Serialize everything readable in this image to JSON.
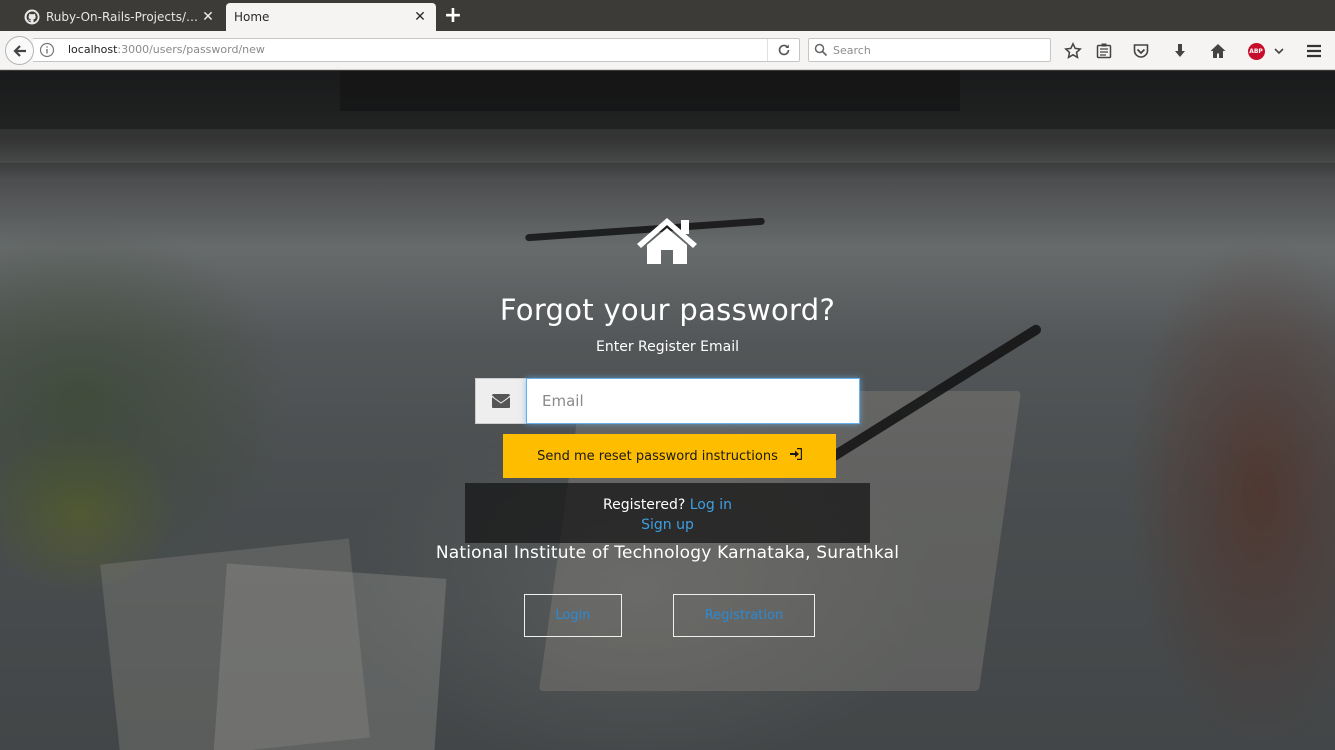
{
  "browser": {
    "tabs": [
      {
        "title": "Ruby-On-Rails-Projects/Log in",
        "active": false,
        "favicon": "github-icon"
      },
      {
        "title": "Home",
        "active": true
      }
    ],
    "url": {
      "host": "localhost",
      "rest": ":3000/users/password/new"
    },
    "search_placeholder": "Search",
    "abp_label": "ABP"
  },
  "page": {
    "heading": "Forgot your password?",
    "subheading": "Enter Register Email",
    "email_placeholder": "Email",
    "reset_button": "Send me reset password instructions",
    "registered_text": "Registered?",
    "login_link": "Log in",
    "signup_link": "Sign up",
    "institute": "National Institute of Technology Karnataka, Surathkal",
    "login_button": "Login",
    "registration_button": "Registration",
    "colors": {
      "accent": "#ffbd00",
      "link": "#3f9fe0"
    }
  }
}
